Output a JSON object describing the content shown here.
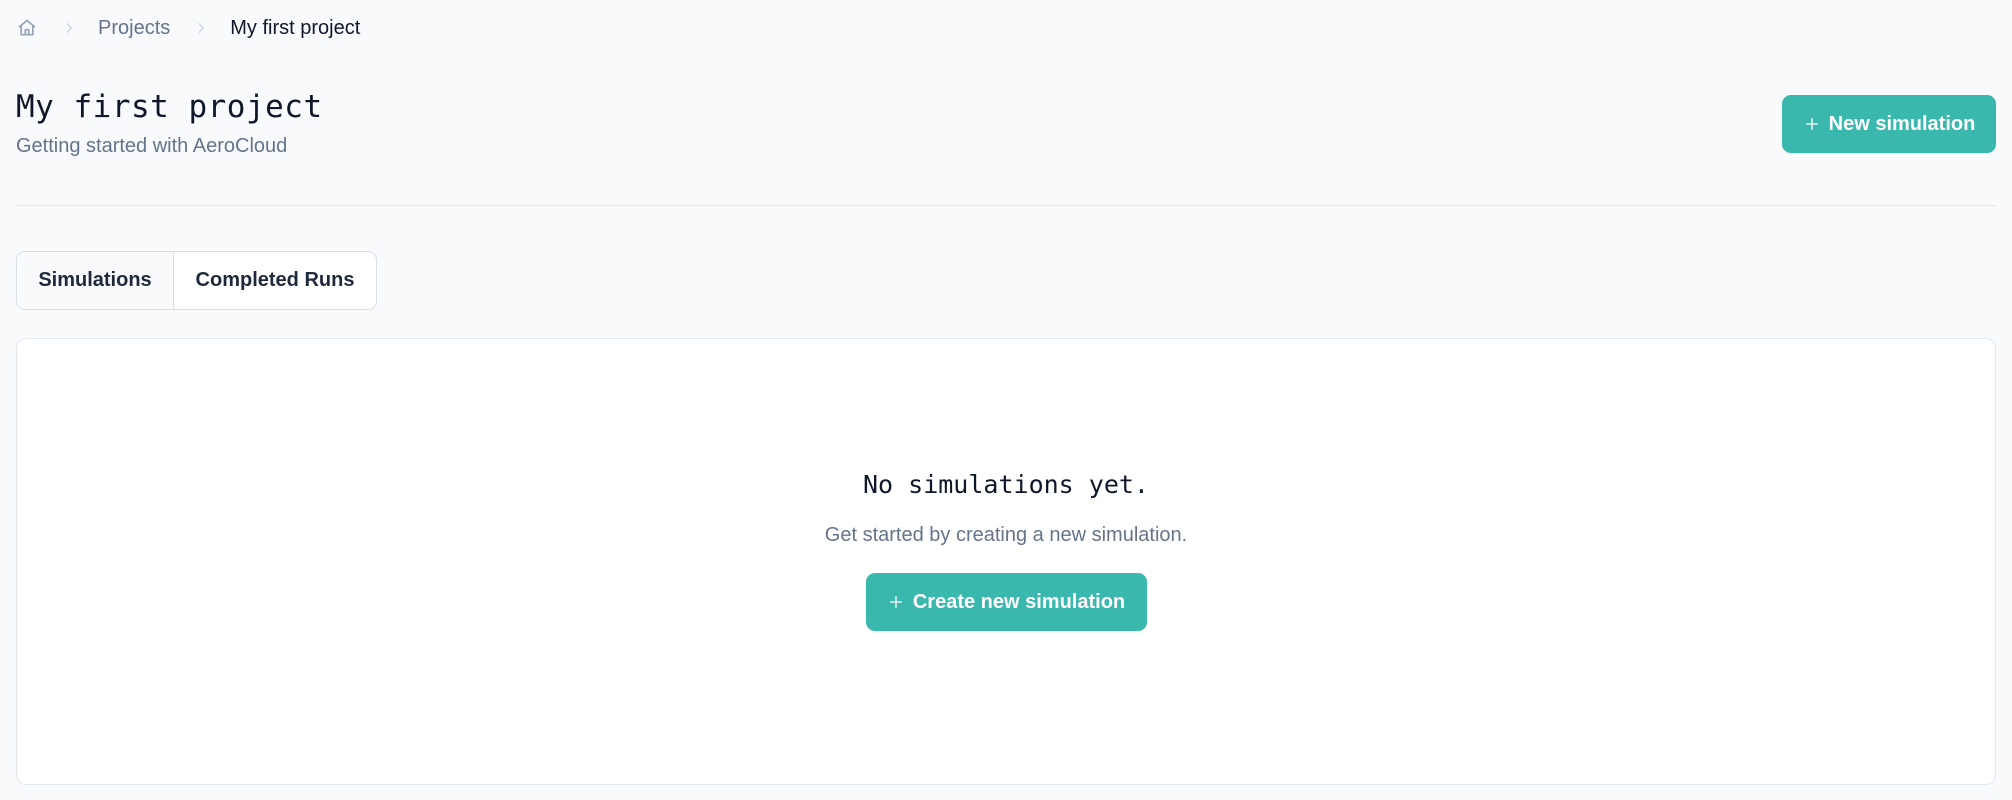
{
  "breadcrumb": {
    "home_icon": "home-icon",
    "separator_icon": "chevron-right-icon",
    "projects": "Projects",
    "current": "My first project"
  },
  "header": {
    "title": "My first project",
    "subtitle": "Getting started with AeroCloud",
    "new_simulation_label": "New simulation",
    "new_simulation_icon": "plus-icon"
  },
  "tabs": [
    {
      "label": "Simulations",
      "active": true
    },
    {
      "label": "Completed Runs",
      "active": false
    }
  ],
  "empty_state": {
    "title": "No simulations yet.",
    "description": "Get started by creating a new simulation.",
    "button_label": "Create new simulation",
    "button_icon": "plus-icon"
  },
  "colors": {
    "accent": "#3bb8ad",
    "background": "#f8fafc",
    "panel": "#ffffff",
    "muted_text": "#64748b",
    "text": "#0f172a"
  }
}
